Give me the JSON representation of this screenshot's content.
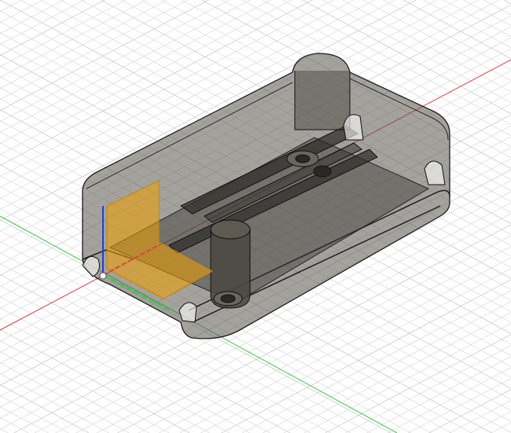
{
  "viewport": {
    "background": "#ffffff",
    "grid_color": "#d9d9d9",
    "grid_major_color": "#c4c4c4"
  },
  "axes": {
    "x_color": "#e04848",
    "y_color": "#3cc84a",
    "z_color": "#2a3cd8"
  },
  "model": {
    "body_fill": "#5a554c",
    "body_edge": "#1e1e1e",
    "sketch_plane_color": "#f0a000"
  }
}
